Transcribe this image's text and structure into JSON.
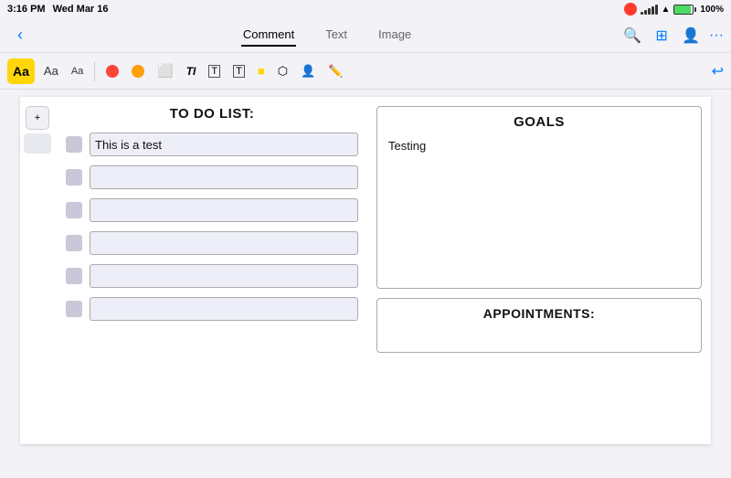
{
  "statusBar": {
    "time": "3:16 PM",
    "date": "Wed Mar 16",
    "batteryPercent": "100%",
    "signals": [
      3,
      5,
      7,
      9,
      11
    ]
  },
  "navBar": {
    "backLabel": "‹",
    "tabs": [
      {
        "id": "comment",
        "label": "Comment",
        "active": true
      },
      {
        "id": "text",
        "label": "Text",
        "active": false
      },
      {
        "id": "image",
        "label": "Image",
        "active": false
      }
    ],
    "searchIcon": "🔍",
    "gridIcon": "⊞",
    "personIcon": "👤",
    "moreIcon": "···"
  },
  "toolbar": {
    "fontLarge": "Aa",
    "fontMedium": "Aa",
    "fontSmall": "Aa",
    "penRedColor": "#ff453a",
    "penOrangeColor": "#ff9f0a",
    "eraserIcon": "eraser",
    "textIcon": "TI",
    "textBoxIcon": "T",
    "textBoxFilledIcon": "T",
    "highlightIcon": "highlight",
    "shapeIcon": "shape",
    "stampIcon": "stamp",
    "penFreeIcon": "pen",
    "undoIcon": "↩"
  },
  "page": {
    "addButtonLabel": "+",
    "todo": {
      "title": "TO DO LIST:",
      "rows": [
        {
          "id": 1,
          "value": "This is a test",
          "placeholder": ""
        },
        {
          "id": 2,
          "value": "",
          "placeholder": ""
        },
        {
          "id": 3,
          "value": "",
          "placeholder": ""
        },
        {
          "id": 4,
          "value": "",
          "placeholder": ""
        },
        {
          "id": 5,
          "value": "",
          "placeholder": ""
        },
        {
          "id": 6,
          "value": "",
          "placeholder": ""
        }
      ]
    },
    "goals": {
      "title": "GOALS",
      "content": "Testing"
    },
    "appointments": {
      "title": "APPOINTMENTS:"
    }
  }
}
